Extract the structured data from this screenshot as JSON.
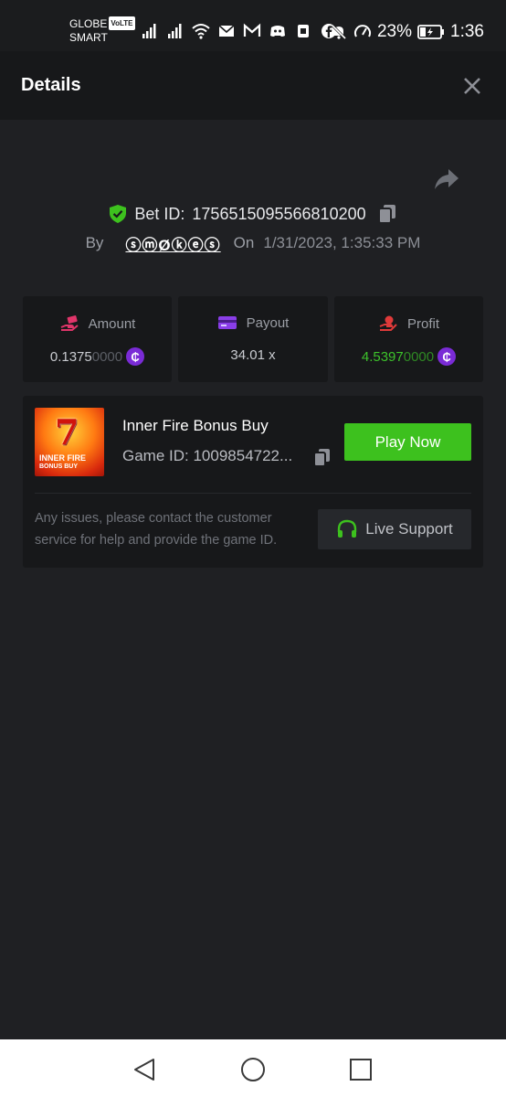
{
  "status_bar": {
    "carrier_line1": "GLOBE",
    "carrier_badge": "VoLTE",
    "carrier_line2": "SMART",
    "battery": "23%",
    "time": "1:36"
  },
  "header": {
    "title": "Details"
  },
  "bet": {
    "bet_id_label": "Bet ID:",
    "bet_id": "1756515095566810200",
    "by_label": "By",
    "user": "ⓢⓜØⓚⓔⓢ",
    "on_label": "On",
    "date": "1/31/2023, 1:35:33 PM"
  },
  "stats": {
    "amount": {
      "label": "Amount",
      "value_main": "0.1375",
      "value_dim": "0000"
    },
    "payout": {
      "label": "Payout",
      "value": "34.01 x"
    },
    "profit": {
      "label": "Profit",
      "value_main": "4.5397",
      "value_dim": "0000"
    },
    "coin_symbol": "₵"
  },
  "game": {
    "thumb_line1": "INNER FIRE",
    "thumb_line2": "BONUS BUY",
    "thumb_seven": "7",
    "name": "Inner Fire Bonus Buy",
    "game_id": "Game ID: 1009854722...",
    "play_label": "Play Now",
    "notice": "Any issues, please contact the customer service for help and provide the game ID.",
    "support_label": "Live Support"
  },
  "colors": {
    "accent_green": "#3dc11e",
    "coin_purple": "#7a2bd6",
    "background": "#1f2023"
  }
}
